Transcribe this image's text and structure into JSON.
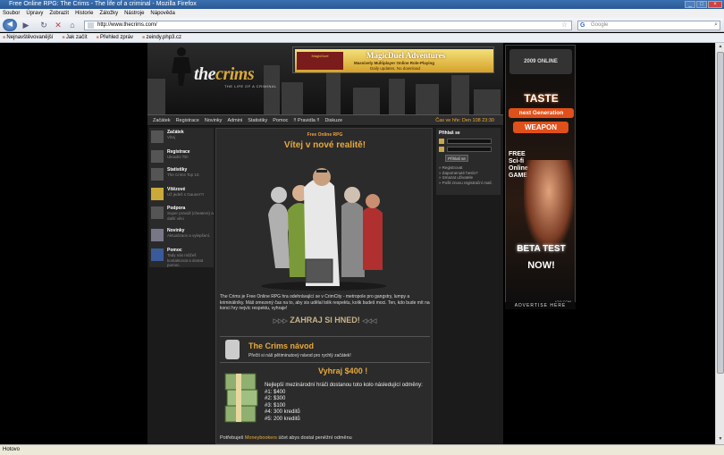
{
  "window": {
    "title": "Free Online RPG: The Crims - The life of a criminal - Mozilla Firefox"
  },
  "menu": [
    "Soubor",
    "Úpravy",
    "Zobrazit",
    "Historie",
    "Záložky",
    "Nástroje",
    "Nápověda"
  ],
  "address": {
    "url": "http://www.thecrims.com/"
  },
  "search": {
    "placeholder": "Google",
    "engine": "G"
  },
  "bookmarks": [
    "Nejnavštěvovanější",
    "Jak začít",
    "Přehled zpráv",
    "zeindy.php3.cz"
  ],
  "status": {
    "text": "Hotovo"
  },
  "site": {
    "logo_a": "the",
    "logo_b": "crims",
    "tagline": "THE LIFE OF A CRIMINAL",
    "banner": {
      "badge_top": "MagicDuel",
      "title": "MagicDuel Adventures",
      "line1": "Massively Multiplayer Online Role-Playing",
      "line2": "Daily updates, No download"
    },
    "nav": [
      "Začátek",
      "Registrace",
      "Novinky",
      "Admini",
      "Statistiky",
      "Pomoc",
      "!! Pravidla !!",
      "Diskuze"
    ],
    "time": "Čas ve hře: Den 108 23:30",
    "left_menu": [
      {
        "title": "Začátek",
        "desc": "Vítej"
      },
      {
        "title": "Registrace",
        "desc": "Ukradni TE!"
      },
      {
        "title": "Statistiky",
        "desc": "The Crims Top 10."
      },
      {
        "title": "Vítězové",
        "desc": "Už jedeš s Gauner?!"
      },
      {
        "title": "Podpora",
        "desc": "Super pravidl (cheaters) a další věci"
      },
      {
        "title": "Novinky",
        "desc": "Aktualizace a vylepšení."
      },
      {
        "title": "Pomoc",
        "desc": "Tady nás můžeš kontaktovat a dostat pomoc."
      }
    ],
    "center": {
      "subtitle": "Free Online RPG",
      "welcome": "Vítej v nové realitě!",
      "intro": "The Crims je Free Online RPG hra odehrávající se v CrimCity - metropole pro gangstry, lumpy a kriminálníky. Máš omezený čas na to, aby sis udělal tolik respektu, kolik budeš moci. Ten, kdo bude mít na konci hry nejvíc respektu, vyhraje!",
      "play": "ZAHRAJ SI HNED!",
      "play_arrows_left": "▷▷▷",
      "play_arrows_right": "◁◁◁",
      "guide_title": "The Crims návod",
      "guide_desc": "Přečti si náš pětiminutový návod pro rychlý začátek!",
      "prize_title": "Vyhraj $400 !",
      "prize_lines": [
        "Nejlepší mezinárodní hráči dostanou toto kolo následující odměny:",
        "#1: $400",
        "#2: $300",
        "#3: $100",
        "#4: 300 kreditů",
        "#5: 200 kreditů"
      ],
      "money_a": "Potřebuješ",
      "money_link": "Moneybookers",
      "money_b": "účet abys dostal peněžní odměnu"
    },
    "login": {
      "title": "Přihlaš se",
      "button": "Přihlaš se",
      "links": [
        "» Registrovat",
        "» Zapomenuté heslo?",
        "» Smazat uživatele",
        "» Pošli znovu registrační mail."
      ]
    },
    "ad": {
      "year": "2009 ONLINE",
      "taste": "TASTE",
      "nextgen": "next Generation",
      "weapon": "WEAPON",
      "free": "FREE Sci-fi Online GAME",
      "beta": "BETA TEST",
      "now": "NOW!",
      "igg": "IGG.COM",
      "label": "ADVERTISE HERE"
    }
  }
}
